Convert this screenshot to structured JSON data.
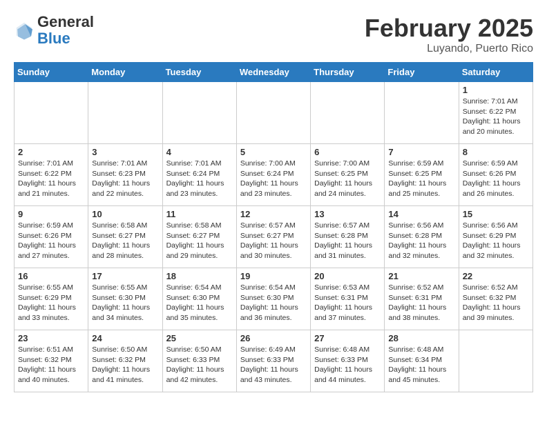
{
  "header": {
    "logo_general": "General",
    "logo_blue": "Blue",
    "title": "February 2025",
    "subtitle": "Luyando, Puerto Rico"
  },
  "days_of_week": [
    "Sunday",
    "Monday",
    "Tuesday",
    "Wednesday",
    "Thursday",
    "Friday",
    "Saturday"
  ],
  "weeks": [
    [
      {
        "day": "",
        "info": ""
      },
      {
        "day": "",
        "info": ""
      },
      {
        "day": "",
        "info": ""
      },
      {
        "day": "",
        "info": ""
      },
      {
        "day": "",
        "info": ""
      },
      {
        "day": "",
        "info": ""
      },
      {
        "day": "1",
        "info": "Sunrise: 7:01 AM\nSunset: 6:22 PM\nDaylight: 11 hours\nand 20 minutes."
      }
    ],
    [
      {
        "day": "2",
        "info": "Sunrise: 7:01 AM\nSunset: 6:22 PM\nDaylight: 11 hours\nand 21 minutes."
      },
      {
        "day": "3",
        "info": "Sunrise: 7:01 AM\nSunset: 6:23 PM\nDaylight: 11 hours\nand 22 minutes."
      },
      {
        "day": "4",
        "info": "Sunrise: 7:01 AM\nSunset: 6:24 PM\nDaylight: 11 hours\nand 23 minutes."
      },
      {
        "day": "5",
        "info": "Sunrise: 7:00 AM\nSunset: 6:24 PM\nDaylight: 11 hours\nand 23 minutes."
      },
      {
        "day": "6",
        "info": "Sunrise: 7:00 AM\nSunset: 6:25 PM\nDaylight: 11 hours\nand 24 minutes."
      },
      {
        "day": "7",
        "info": "Sunrise: 6:59 AM\nSunset: 6:25 PM\nDaylight: 11 hours\nand 25 minutes."
      },
      {
        "day": "8",
        "info": "Sunrise: 6:59 AM\nSunset: 6:26 PM\nDaylight: 11 hours\nand 26 minutes."
      }
    ],
    [
      {
        "day": "9",
        "info": "Sunrise: 6:59 AM\nSunset: 6:26 PM\nDaylight: 11 hours\nand 27 minutes."
      },
      {
        "day": "10",
        "info": "Sunrise: 6:58 AM\nSunset: 6:27 PM\nDaylight: 11 hours\nand 28 minutes."
      },
      {
        "day": "11",
        "info": "Sunrise: 6:58 AM\nSunset: 6:27 PM\nDaylight: 11 hours\nand 29 minutes."
      },
      {
        "day": "12",
        "info": "Sunrise: 6:57 AM\nSunset: 6:27 PM\nDaylight: 11 hours\nand 30 minutes."
      },
      {
        "day": "13",
        "info": "Sunrise: 6:57 AM\nSunset: 6:28 PM\nDaylight: 11 hours\nand 31 minutes."
      },
      {
        "day": "14",
        "info": "Sunrise: 6:56 AM\nSunset: 6:28 PM\nDaylight: 11 hours\nand 32 minutes."
      },
      {
        "day": "15",
        "info": "Sunrise: 6:56 AM\nSunset: 6:29 PM\nDaylight: 11 hours\nand 32 minutes."
      }
    ],
    [
      {
        "day": "16",
        "info": "Sunrise: 6:55 AM\nSunset: 6:29 PM\nDaylight: 11 hours\nand 33 minutes."
      },
      {
        "day": "17",
        "info": "Sunrise: 6:55 AM\nSunset: 6:30 PM\nDaylight: 11 hours\nand 34 minutes."
      },
      {
        "day": "18",
        "info": "Sunrise: 6:54 AM\nSunset: 6:30 PM\nDaylight: 11 hours\nand 35 minutes."
      },
      {
        "day": "19",
        "info": "Sunrise: 6:54 AM\nSunset: 6:30 PM\nDaylight: 11 hours\nand 36 minutes."
      },
      {
        "day": "20",
        "info": "Sunrise: 6:53 AM\nSunset: 6:31 PM\nDaylight: 11 hours\nand 37 minutes."
      },
      {
        "day": "21",
        "info": "Sunrise: 6:52 AM\nSunset: 6:31 PM\nDaylight: 11 hours\nand 38 minutes."
      },
      {
        "day": "22",
        "info": "Sunrise: 6:52 AM\nSunset: 6:32 PM\nDaylight: 11 hours\nand 39 minutes."
      }
    ],
    [
      {
        "day": "23",
        "info": "Sunrise: 6:51 AM\nSunset: 6:32 PM\nDaylight: 11 hours\nand 40 minutes."
      },
      {
        "day": "24",
        "info": "Sunrise: 6:50 AM\nSunset: 6:32 PM\nDaylight: 11 hours\nand 41 minutes."
      },
      {
        "day": "25",
        "info": "Sunrise: 6:50 AM\nSunset: 6:33 PM\nDaylight: 11 hours\nand 42 minutes."
      },
      {
        "day": "26",
        "info": "Sunrise: 6:49 AM\nSunset: 6:33 PM\nDaylight: 11 hours\nand 43 minutes."
      },
      {
        "day": "27",
        "info": "Sunrise: 6:48 AM\nSunset: 6:33 PM\nDaylight: 11 hours\nand 44 minutes."
      },
      {
        "day": "28",
        "info": "Sunrise: 6:48 AM\nSunset: 6:34 PM\nDaylight: 11 hours\nand 45 minutes."
      },
      {
        "day": "",
        "info": ""
      }
    ]
  ]
}
